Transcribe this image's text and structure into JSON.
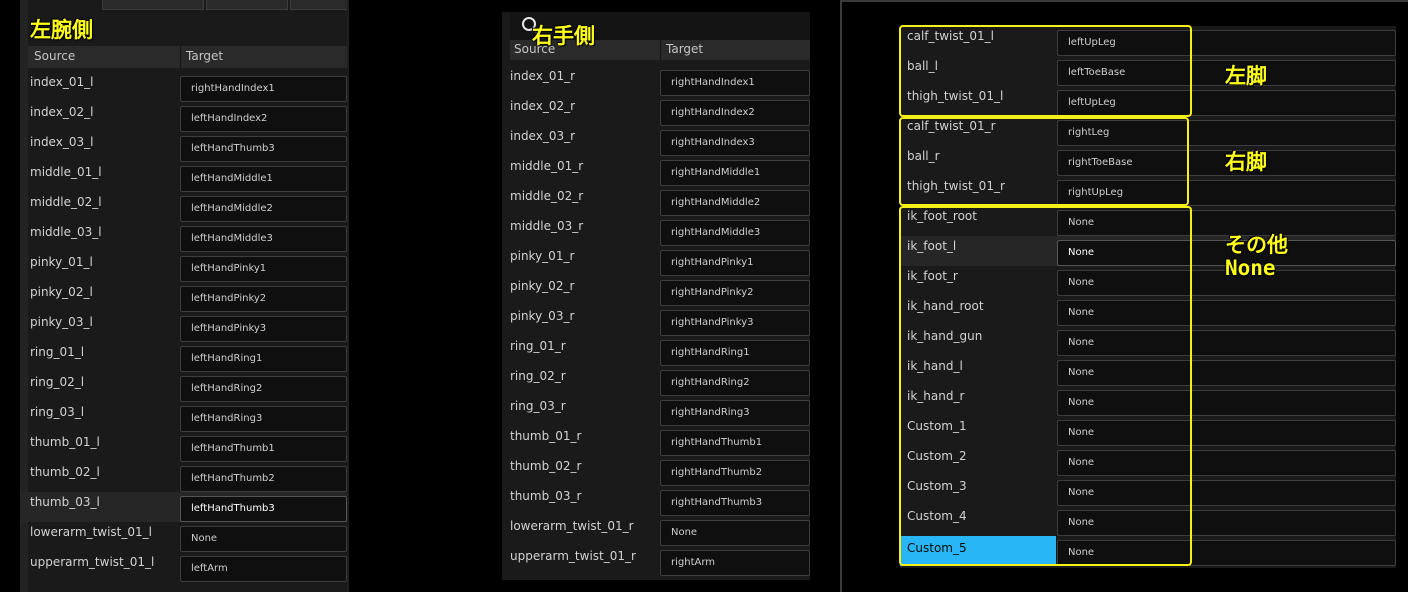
{
  "annotations": {
    "left_arm": "左腕側",
    "right_hand": "右手側",
    "left_leg": "左脚",
    "right_leg": "右脚",
    "other_line1": "その他",
    "other_line2": "None"
  },
  "columns": {
    "source": "Source",
    "target": "Target"
  },
  "panel1": {
    "rows": [
      {
        "source": "index_01_l",
        "target": "rightHandIndex1"
      },
      {
        "source": "index_02_l",
        "target": "leftHandIndex2"
      },
      {
        "source": "index_03_l",
        "target": "leftHandThumb3"
      },
      {
        "source": "middle_01_l",
        "target": "leftHandMiddle1"
      },
      {
        "source": "middle_02_l",
        "target": "leftHandMiddle2"
      },
      {
        "source": "middle_03_l",
        "target": "leftHandMiddle3"
      },
      {
        "source": "pinky_01_l",
        "target": "leftHandPinky1"
      },
      {
        "source": "pinky_02_l",
        "target": "leftHandPinky2"
      },
      {
        "source": "pinky_03_l",
        "target": "leftHandPinky3"
      },
      {
        "source": "ring_01_l",
        "target": "leftHandRing1"
      },
      {
        "source": "ring_02_l",
        "target": "leftHandRing2"
      },
      {
        "source": "ring_03_l",
        "target": "leftHandRing3"
      },
      {
        "source": "thumb_01_l",
        "target": "leftHandThumb1"
      },
      {
        "source": "thumb_02_l",
        "target": "leftHandThumb2"
      },
      {
        "source": "thumb_03_l",
        "target": "leftHandThumb3"
      },
      {
        "source": "lowerarm_twist_01_l",
        "target": "None"
      },
      {
        "source": "upperarm_twist_01_l",
        "target": "leftArm"
      }
    ]
  },
  "panel2": {
    "rows": [
      {
        "source": "index_01_r",
        "target": "rightHandIndex1"
      },
      {
        "source": "index_02_r",
        "target": "rightHandIndex2"
      },
      {
        "source": "index_03_r",
        "target": "rightHandIndex3"
      },
      {
        "source": "middle_01_r",
        "target": "rightHandMiddle1"
      },
      {
        "source": "middle_02_r",
        "target": "rightHandMiddle2"
      },
      {
        "source": "middle_03_r",
        "target": "rightHandMiddle3"
      },
      {
        "source": "pinky_01_r",
        "target": "rightHandPinky1"
      },
      {
        "source": "pinky_02_r",
        "target": "rightHandPinky2"
      },
      {
        "source": "pinky_03_r",
        "target": "rightHandPinky3"
      },
      {
        "source": "ring_01_r",
        "target": "rightHandRing1"
      },
      {
        "source": "ring_02_r",
        "target": "rightHandRing2"
      },
      {
        "source": "ring_03_r",
        "target": "rightHandRing3"
      },
      {
        "source": "thumb_01_r",
        "target": "rightHandThumb1"
      },
      {
        "source": "thumb_02_r",
        "target": "rightHandThumb2"
      },
      {
        "source": "thumb_03_r",
        "target": "rightHandThumb3"
      },
      {
        "source": "lowerarm_twist_01_r",
        "target": "None"
      },
      {
        "source": "upperarm_twist_01_r",
        "target": "rightArm"
      }
    ]
  },
  "panel3": {
    "rows": [
      {
        "source": "calf_twist_01_l",
        "target": "leftUpLeg"
      },
      {
        "source": "ball_l",
        "target": "leftToeBase"
      },
      {
        "source": "thigh_twist_01_l",
        "target": "leftUpLeg"
      },
      {
        "source": "calf_twist_01_r",
        "target": "rightLeg"
      },
      {
        "source": "ball_r",
        "target": "rightToeBase"
      },
      {
        "source": "thigh_twist_01_r",
        "target": "rightUpLeg"
      },
      {
        "source": "ik_foot_root",
        "target": "None"
      },
      {
        "source": "ik_foot_l",
        "target": "None"
      },
      {
        "source": "ik_foot_r",
        "target": "None"
      },
      {
        "source": "ik_hand_root",
        "target": "None"
      },
      {
        "source": "ik_hand_gun",
        "target": "None"
      },
      {
        "source": "ik_hand_l",
        "target": "None"
      },
      {
        "source": "ik_hand_r",
        "target": "None"
      },
      {
        "source": "Custom_1",
        "target": "None"
      },
      {
        "source": "Custom_2",
        "target": "None"
      },
      {
        "source": "Custom_3",
        "target": "None"
      },
      {
        "source": "Custom_4",
        "target": "None"
      },
      {
        "source": "Custom_5",
        "target": "None"
      }
    ]
  },
  "colors": {
    "annotation": "#ffff1a",
    "selection": "#29b6f6",
    "panel_bg": "#1a1a1a"
  }
}
